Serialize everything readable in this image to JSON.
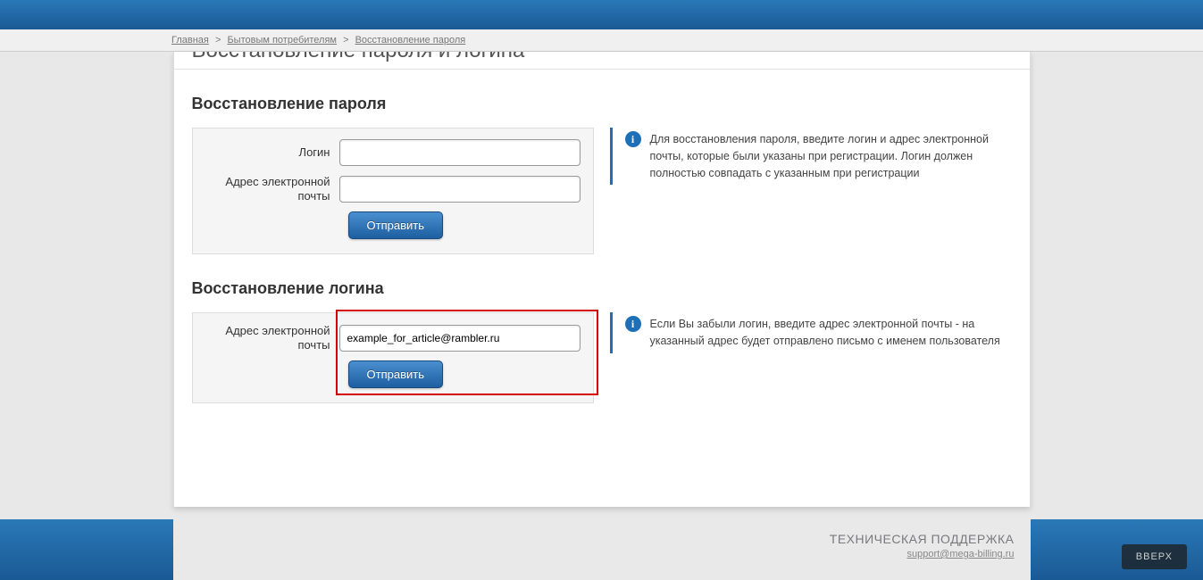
{
  "breadcrumb": {
    "items": [
      "Главная",
      "Бытовым потребителям",
      "Восстановление пароля"
    ],
    "sep": ">"
  },
  "page_title_cut": "Восстановление пароля и логина",
  "password": {
    "section_title": "Восстановление пароля",
    "login_label": "Логин",
    "email_label": "Адрес электронной почты",
    "login_value": "",
    "email_value": "",
    "submit_label": "Отправить",
    "info_text": "Для восстановления пароля, введите логин и адрес электронной почты, которые были указаны при регистрации. Логин должен полностью совпадать с указанным при регистрации"
  },
  "login": {
    "section_title": "Восстановление логина",
    "email_label": "Адрес электронной почты",
    "email_value": "example_for_article@rambler.ru",
    "submit_label": "Отправить",
    "info_text": "Если Вы забыли логин, введите адрес электронной почты - на указанный адрес будет отправлено письмо с именем пользователя"
  },
  "footer": {
    "title": "ТЕХНИЧЕСКАЯ ПОДДЕРЖКА",
    "email": "support@mega-billing.ru",
    "top_button": "ВВЕРХ"
  }
}
